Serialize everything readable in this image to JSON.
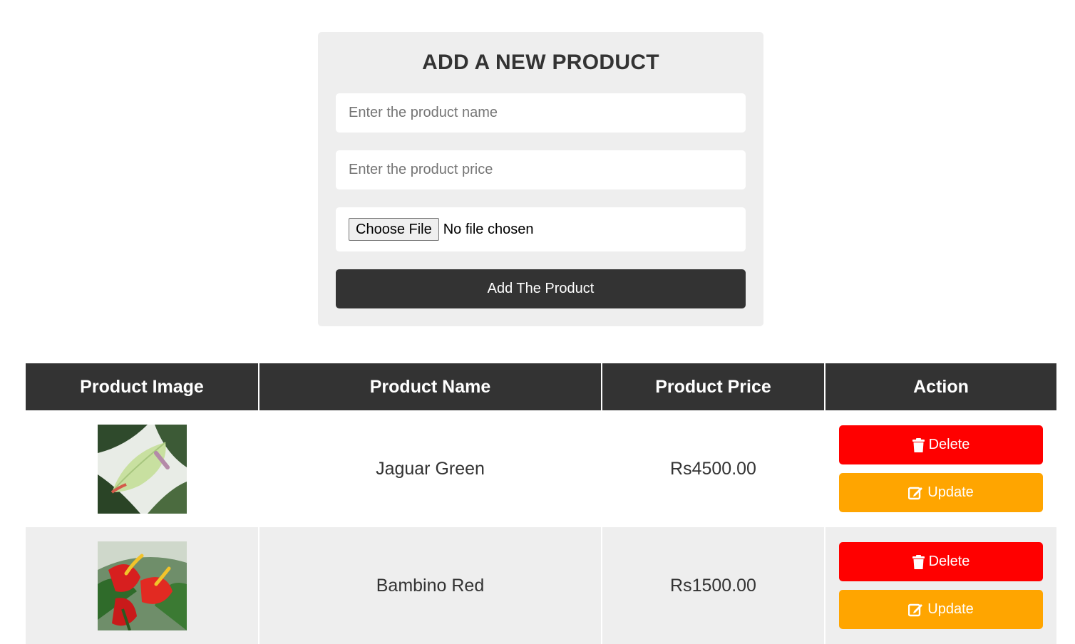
{
  "form": {
    "title": "ADD A NEW PRODUCT",
    "name_placeholder": "Enter the product name",
    "price_placeholder": "Enter the product price",
    "file_button": "Choose File",
    "file_status": "No file chosen",
    "submit_label": "Add The Product"
  },
  "table": {
    "headers": [
      "Product Image",
      "Product Name",
      "Product Price",
      "Action"
    ],
    "rows": [
      {
        "name": "Jaguar Green",
        "price": "Rs4500.00",
        "image_icon": "anthurium-green-photo",
        "delete_label": "Delete",
        "update_label": "Update"
      },
      {
        "name": "Bambino Red",
        "price": "Rs1500.00",
        "image_icon": "anthurium-red-photo",
        "delete_label": "Delete",
        "update_label": "Update"
      }
    ]
  },
  "colors": {
    "header_bg": "#333333",
    "delete": "#ff0000",
    "update": "#ffa500",
    "card_bg": "#eeeeee"
  },
  "icons": {
    "delete": "trash-icon",
    "update": "edit-icon"
  }
}
